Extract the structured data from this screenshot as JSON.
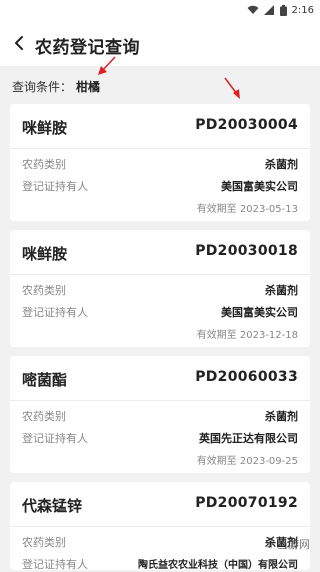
{
  "status_bar": {
    "time": "2:16"
  },
  "header": {
    "title": "农药登记查询"
  },
  "query": {
    "label": "查询条件：",
    "value": "柑橘"
  },
  "field_labels": {
    "type": "农药类别",
    "holder": "登记证持有人",
    "expiry_prefix": "有效期至"
  },
  "records": [
    {
      "name": "咪鲜胺",
      "code": "PD20030004",
      "type": "杀菌剂",
      "holder": "美国富美实公司",
      "expiry": "2023-05-13"
    },
    {
      "name": "咪鲜胺",
      "code": "PD20030018",
      "type": "杀菌剂",
      "holder": "美国富美实公司",
      "expiry": "2023-12-18"
    },
    {
      "name": "嘧菌酯",
      "code": "PD20060033",
      "type": "杀菌剂",
      "holder": "英国先正达有限公司",
      "expiry": "2023-09-25"
    },
    {
      "name": "代森锰锌",
      "code": "PD20070192",
      "type": "杀菌剂",
      "holder": "陶氏益农农业科技（中国）有限公司",
      "expiry": ""
    }
  ],
  "watermark": "ꀊ 当游网"
}
